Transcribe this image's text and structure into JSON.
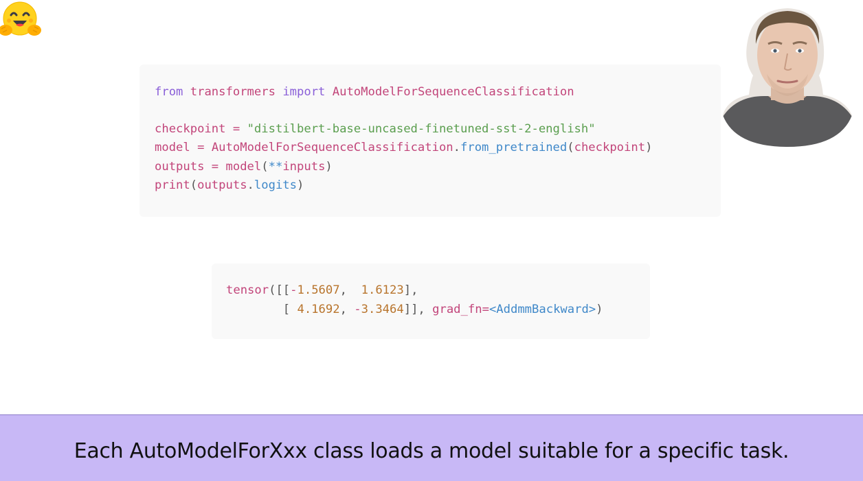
{
  "logo": {
    "icon": "hugging-face-emoji-icon"
  },
  "code_main": {
    "lines": [
      {
        "tokens": [
          {
            "t": "from",
            "c": "kw"
          },
          {
            "t": " ",
            "c": "pl"
          },
          {
            "t": "transformers",
            "c": "id"
          },
          {
            "t": " ",
            "c": "pl"
          },
          {
            "t": "import",
            "c": "kw"
          },
          {
            "t": " ",
            "c": "pl"
          },
          {
            "t": "AutoModelForSequenceClassification",
            "c": "id"
          }
        ]
      },
      {
        "tokens": []
      },
      {
        "tokens": [
          {
            "t": "checkpoint",
            "c": "id"
          },
          {
            "t": " ",
            "c": "pl"
          },
          {
            "t": "=",
            "c": "op"
          },
          {
            "t": " ",
            "c": "pl"
          },
          {
            "t": "\"distilbert-base-uncased-finetuned-sst-2-english\"",
            "c": "str"
          }
        ]
      },
      {
        "tokens": [
          {
            "t": "model",
            "c": "id"
          },
          {
            "t": " ",
            "c": "pl"
          },
          {
            "t": "=",
            "c": "op"
          },
          {
            "t": " ",
            "c": "pl"
          },
          {
            "t": "AutoModelForSequenceClassification",
            "c": "id"
          },
          {
            "t": ".",
            "c": "pl"
          },
          {
            "t": "from_pretrained",
            "c": "fn"
          },
          {
            "t": "(",
            "c": "pl"
          },
          {
            "t": "checkpoint",
            "c": "id"
          },
          {
            "t": ")",
            "c": "pl"
          }
        ]
      },
      {
        "tokens": [
          {
            "t": "outputs",
            "c": "id"
          },
          {
            "t": " ",
            "c": "pl"
          },
          {
            "t": "=",
            "c": "op"
          },
          {
            "t": " ",
            "c": "pl"
          },
          {
            "t": "model",
            "c": "id"
          },
          {
            "t": "(",
            "c": "pl"
          },
          {
            "t": "**",
            "c": "star"
          },
          {
            "t": "inputs",
            "c": "id"
          },
          {
            "t": ")",
            "c": "pl"
          }
        ]
      },
      {
        "tokens": [
          {
            "t": "print",
            "c": "id"
          },
          {
            "t": "(",
            "c": "pl"
          },
          {
            "t": "outputs",
            "c": "id"
          },
          {
            "t": ".",
            "c": "pl"
          },
          {
            "t": "logits",
            "c": "fn"
          },
          {
            "t": ")",
            "c": "pl"
          }
        ]
      }
    ]
  },
  "code_output": {
    "lines": [
      {
        "tokens": [
          {
            "t": "tensor",
            "c": "id"
          },
          {
            "t": "([[",
            "c": "pl"
          },
          {
            "t": "-",
            "c": "minus"
          },
          {
            "t": "1.5607",
            "c": "num"
          },
          {
            "t": ",  ",
            "c": "pl"
          },
          {
            "t": "1.6123",
            "c": "num"
          },
          {
            "t": "],",
            "c": "pl"
          }
        ]
      },
      {
        "tokens": [
          {
            "t": "        [ ",
            "c": "pl"
          },
          {
            "t": "4.1692",
            "c": "num"
          },
          {
            "t": ", ",
            "c": "pl"
          },
          {
            "t": "-",
            "c": "minus"
          },
          {
            "t": "3.3464",
            "c": "num"
          },
          {
            "t": "]], ",
            "c": "pl"
          },
          {
            "t": "grad_fn",
            "c": "id"
          },
          {
            "t": "=",
            "c": "op"
          },
          {
            "t": "<AddmmBackward>",
            "c": "fn"
          },
          {
            "t": ")",
            "c": "pl"
          }
        ]
      }
    ]
  },
  "presenter": {
    "icon": "presenter-webcam-portrait"
  },
  "caption": {
    "text": "Each AutoModelForXxx class loads a model suitable for a specific task."
  }
}
